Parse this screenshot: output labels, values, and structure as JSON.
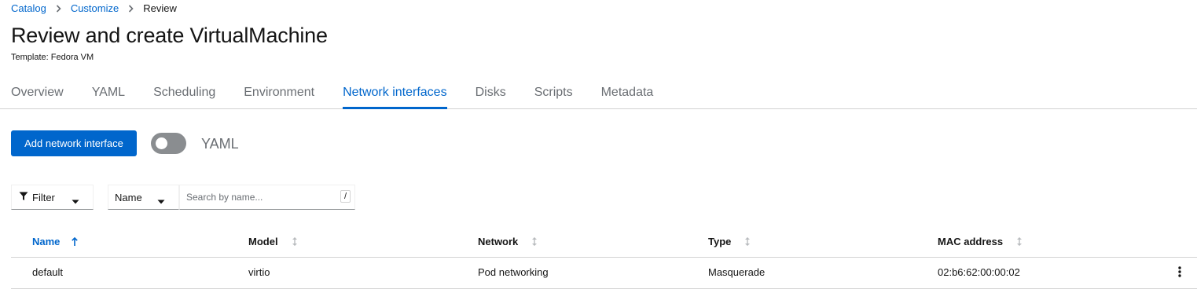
{
  "breadcrumb": {
    "items": [
      {
        "label": "Catalog"
      },
      {
        "label": "Customize"
      }
    ],
    "current": "Review"
  },
  "page": {
    "title": "Review and create VirtualMachine",
    "subtitle": "Template: Fedora VM"
  },
  "tabs": [
    {
      "label": "Overview"
    },
    {
      "label": "YAML"
    },
    {
      "label": "Scheduling"
    },
    {
      "label": "Environment"
    },
    {
      "label": "Network interfaces",
      "active": true
    },
    {
      "label": "Disks"
    },
    {
      "label": "Scripts"
    },
    {
      "label": "Metadata"
    }
  ],
  "toolbar": {
    "add_label": "Add network interface",
    "yaml_toggle_label": "YAML",
    "yaml_toggle_on": false
  },
  "filters": {
    "filter_label": "Filter",
    "attribute_label": "Name",
    "search_placeholder": "Search by name...",
    "search_value": "",
    "shortcut_hint": "/"
  },
  "table": {
    "columns": [
      {
        "label": "Name",
        "sort": "ascending"
      },
      {
        "label": "Model",
        "sort": "none"
      },
      {
        "label": "Network",
        "sort": "none"
      },
      {
        "label": "Type",
        "sort": "none"
      },
      {
        "label": "MAC address",
        "sort": "none"
      }
    ],
    "rows": [
      {
        "name": "default",
        "model": "virtio",
        "network": "Pod networking",
        "type": "Masquerade",
        "mac": "02:b6:62:00:00:02"
      }
    ]
  },
  "colors": {
    "accent": "#0066cc",
    "text": "#151515",
    "muted": "#6a6e73",
    "border": "#d2d2d2"
  },
  "icons": {
    "breadcrumb_separator": "chevron-right-icon",
    "filter": "filter-icon",
    "caret": "caret-down-icon",
    "sort_active": "long-arrow-up-icon",
    "sort_inactive": "arrows-alt-v-icon",
    "row_actions": "kebab-icon"
  }
}
